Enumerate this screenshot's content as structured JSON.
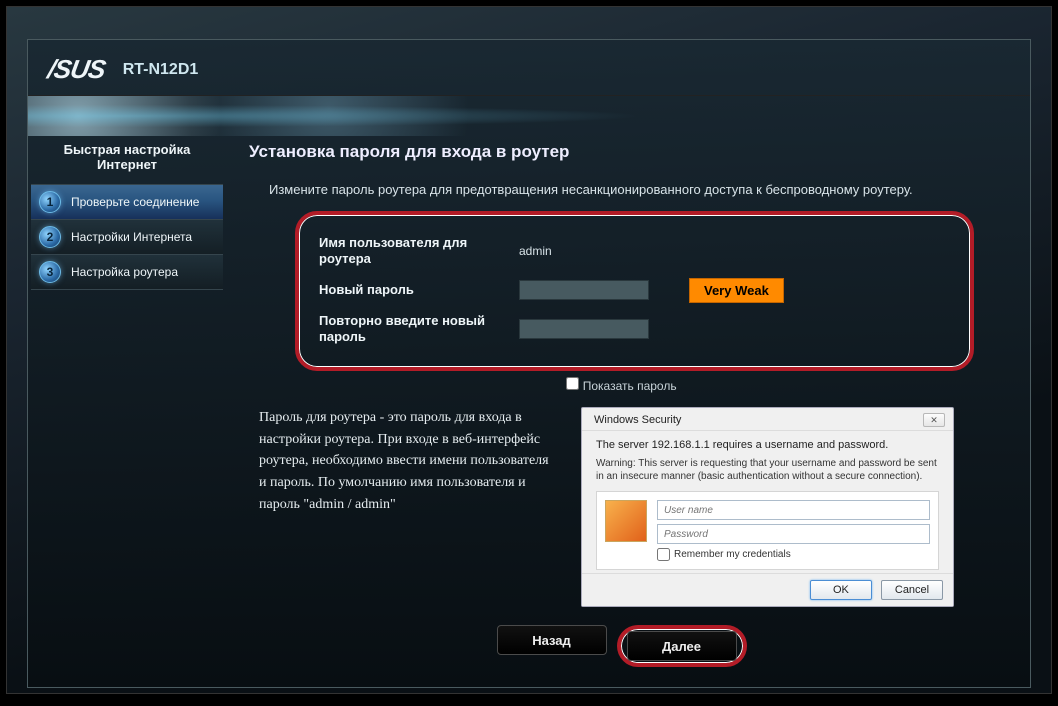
{
  "brand": "/SUS",
  "model": "RT-N12D1",
  "sidebar": {
    "title": "Быстрая настройка Интернет",
    "steps": [
      {
        "num": "1",
        "label": "Проверьте соединение",
        "active": true
      },
      {
        "num": "2",
        "label": "Настройки Интернета",
        "active": false
      },
      {
        "num": "3",
        "label": "Настройка роутера",
        "active": false
      }
    ]
  },
  "page": {
    "title": "Установка пароля для входа в роутер",
    "instruction": "Измените пароль роутера для предотвращения несанкционированного доступа к беспроводному роутеру.",
    "form": {
      "username_label": "Имя пользователя для роутера",
      "username_value": "admin",
      "newpass_label": "Новый пароль",
      "retype_label": "Повторно введите новый пароль",
      "strength": "Very Weak",
      "show_password": "Показать пароль"
    },
    "description": "Пароль для роутера - это пароль для входа в настройки роутера. При входе в веб-интерфейс роутера, необходимо ввести имени пользователя и пароль. По умолчанию имя пользователя и пароль \"admin / admin\"",
    "dialog": {
      "title": "Windows Security",
      "line1": "The server 192.168.1.1  requires a username and password.",
      "warn": "Warning: This server is requesting that your username and password be sent in an insecure manner (basic authentication without a secure connection).",
      "user_ph": "User name",
      "pass_ph": "Password",
      "remember": "Remember my credentials",
      "ok": "OK",
      "cancel": "Cancel"
    },
    "buttons": {
      "back": "Назад",
      "next": "Далее"
    }
  }
}
